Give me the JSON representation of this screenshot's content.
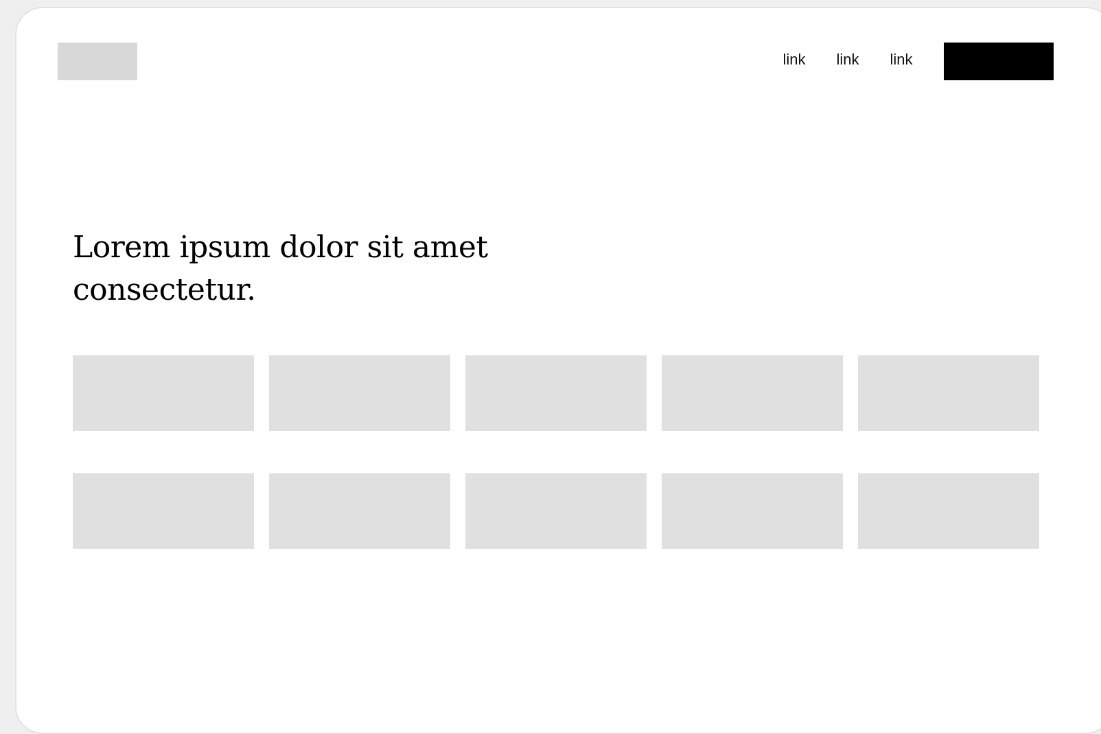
{
  "header": {
    "logo_label": "logo placeholder",
    "nav": [
      "link",
      "link",
      "link"
    ],
    "cta_color": "#000000"
  },
  "hero": {
    "headline": "Lorem ipsum dolor sit amet consectetur."
  },
  "grid": {
    "rows": 2,
    "columns": 5,
    "card_color": "#e0e0e0"
  },
  "colors": {
    "background": "#ffffff",
    "placeholder": "#d8d8d8",
    "outer": "#efefef"
  }
}
